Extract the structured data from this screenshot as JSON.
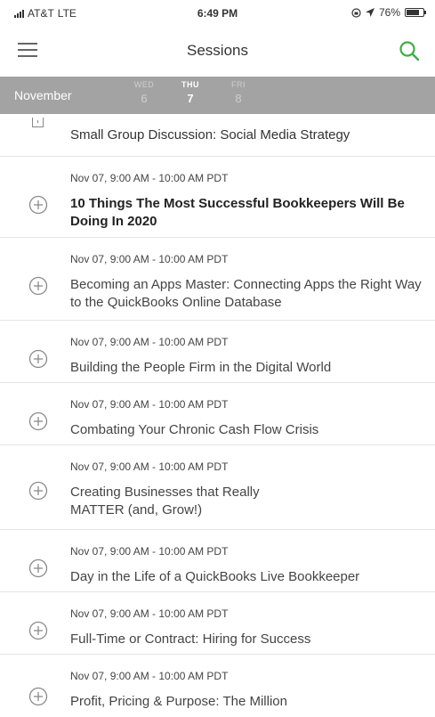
{
  "status": {
    "carrier": "AT&T",
    "network": "LTE",
    "time": "6:49 PM",
    "battery": "76%",
    "battery_level": 0.76
  },
  "nav": {
    "title": "Sessions"
  },
  "date_bar": {
    "month": "November",
    "days": [
      {
        "dow": "WED",
        "num": "6"
      },
      {
        "dow": "THU",
        "num": "7"
      },
      {
        "dow": "FRI",
        "num": "8"
      }
    ],
    "selected_index": 1
  },
  "partial_session": {
    "title": "Small Group Discussion: Social Media Strategy"
  },
  "sessions": [
    {
      "time": "Nov 07, 9:00 AM - 10:00 AM PDT",
      "title": "10 Things The Most Successful Bookkeepers Will Be Doing In 2020",
      "bold": true
    },
    {
      "time": "Nov 07, 9:00 AM - 10:00 AM PDT",
      "title": "Becoming an Apps Master: Connecting Apps the Right Way to the QuickBooks Online Database",
      "bold": false
    },
    {
      "time": "Nov 07, 9:00 AM - 10:00 AM PDT",
      "title": "Building the People Firm in the Digital World",
      "bold": false
    },
    {
      "time": "Nov 07, 9:00 AM - 10:00 AM PDT",
      "title": "Combating Your Chronic Cash Flow Crisis",
      "bold": false
    },
    {
      "time": "Nov 07, 9:00 AM - 10:00 AM PDT",
      "title": "Creating Businesses that Really MATTER (and, Grow!)",
      "bold": false
    },
    {
      "time": "Nov 07, 9:00 AM - 10:00 AM PDT",
      "title": "Day in the Life of a QuickBooks Live Bookkeeper",
      "bold": false
    },
    {
      "time": "Nov 07, 9:00 AM - 10:00 AM PDT",
      "title": "Full-Time or Contract: Hiring for Success",
      "bold": false
    },
    {
      "time": "Nov 07, 9:00 AM - 10:00 AM PDT",
      "title": "Profit, Pricing & Purpose: The Million",
      "bold": false
    }
  ],
  "colors": {
    "accent": "#3cb043",
    "date_bar": "#a3a3a3"
  },
  "icons": {
    "menu": "hamburger-icon",
    "search": "search-icon",
    "add": "add-circle-icon"
  }
}
